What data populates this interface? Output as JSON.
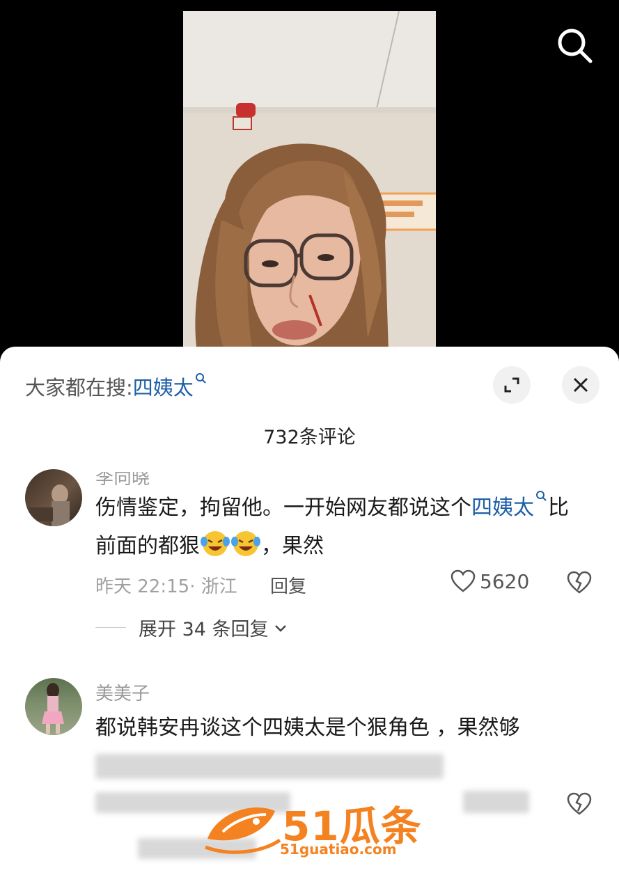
{
  "trending": {
    "prefix": "大家都在搜:",
    "keyword": "四姨太"
  },
  "comment_count": "732条评论",
  "comments": [
    {
      "username": "李向晓",
      "text_before": "伤情鉴定，拘留他。一开始网友都说这个",
      "keyword": "四姨太",
      "text_after": "比前面的都狠",
      "text_tail": "，果然",
      "time_location": "昨天 22:15· 浙江",
      "reply_label": "回复",
      "likes": "5620",
      "expand_label": "展开 34 条回复"
    },
    {
      "username": "美美子",
      "text": "都说韩安冉谈这个四姨太是个狠角色 ，果然够"
    }
  ],
  "watermark": {
    "brand": "51瓜条",
    "url": "51guatiao.com"
  },
  "colors": {
    "link": "#1d5fa8",
    "watermark": "#f58220"
  }
}
